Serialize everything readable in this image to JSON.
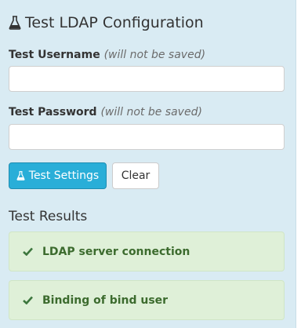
{
  "header": {
    "title": "Test LDAP Configuration",
    "icon": "flask-icon"
  },
  "form": {
    "username": {
      "label": "Test Username",
      "hint": "(will not be saved)",
      "value": "",
      "placeholder": ""
    },
    "password": {
      "label": "Test Password",
      "hint": "(will not be saved)",
      "value": "",
      "placeholder": ""
    }
  },
  "actions": {
    "test_label": "Test Settings",
    "clear_label": "Clear"
  },
  "results": {
    "title": "Test Results",
    "items": [
      {
        "label": "LDAP server connection",
        "status": "success"
      },
      {
        "label": "Binding of bind user",
        "status": "success"
      }
    ]
  },
  "colors": {
    "panel_bg": "#d9ebf3",
    "primary": "#29aed8",
    "success_bg": "#dff0d8",
    "success_text": "#3c763d"
  }
}
